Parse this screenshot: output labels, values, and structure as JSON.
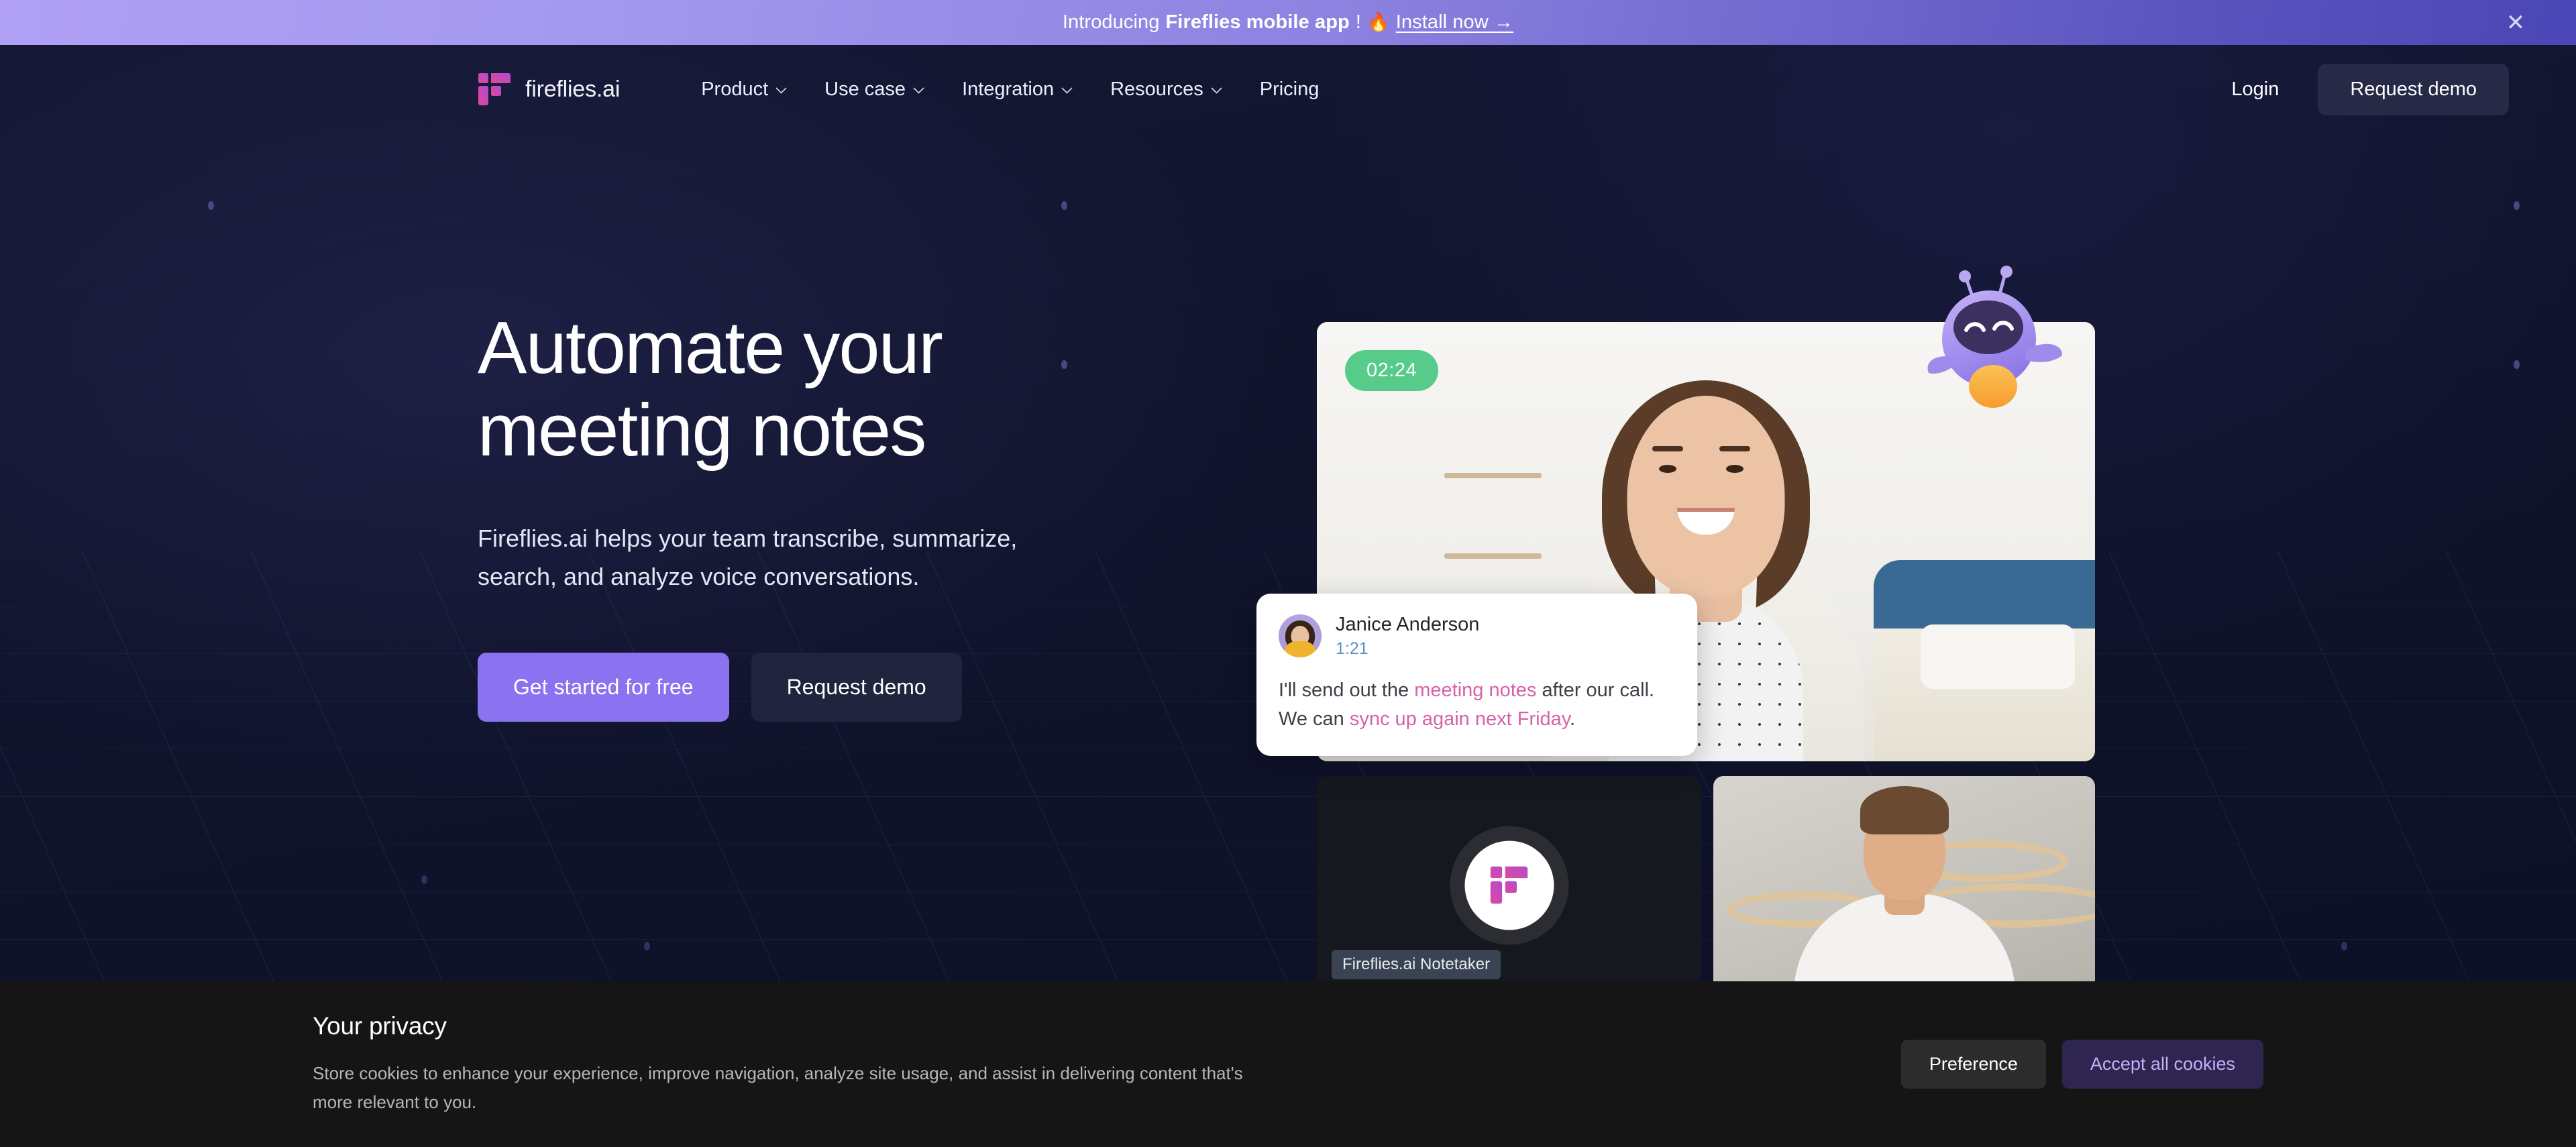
{
  "announcement": {
    "prefix": "Introducing",
    "strong": "Fireflies mobile app",
    "exclaim": "!",
    "emoji": "🔥",
    "link": "Install now →",
    "close_icon": "✕"
  },
  "nav": {
    "brand": "fireflies.ai",
    "logo_icon": "fireflies-logo-icon",
    "items": [
      {
        "label": "Product",
        "has_chevron": true
      },
      {
        "label": "Use case",
        "has_chevron": true
      },
      {
        "label": "Integration",
        "has_chevron": true
      },
      {
        "label": "Resources",
        "has_chevron": true
      },
      {
        "label": "Pricing",
        "has_chevron": false
      }
    ],
    "login_label": "Login",
    "demo_label": "Request demo"
  },
  "hero": {
    "title_line1": "Automate your",
    "title_line2": "meeting notes",
    "subtitle": "Fireflies.ai helps your team transcribe, summarize, search, and analyze voice conversations.",
    "cta_primary": "Get started for free",
    "cta_secondary": "Request demo",
    "accent_color": "#8b72f0"
  },
  "call": {
    "timer": "02:24",
    "timer_color": "#56cb8a",
    "mascot_icon": "fireflies-robot-mascot-icon",
    "transcript": {
      "speaker": "Janice Anderson",
      "timestamp": "1:21",
      "line1_a": "I'll send out the ",
      "line1_hl": "meeting notes",
      "line1_b": " after our call.",
      "line2_a": "We can ",
      "line2_hl": "sync up again next Friday",
      "line2_b": ".",
      "highlight_color": "#d761a8"
    },
    "notetaker_label": "Fireflies.ai Notetaker"
  },
  "cookies": {
    "title": "Your privacy",
    "body": "Store cookies to enhance your experience, improve navigation, analyze site usage, and assist in delivering content that's more relevant to you.",
    "preference_label": "Preference",
    "accept_label": "Accept all cookies",
    "accept_bg": "#2e2550",
    "accept_fg": "#bfb1f5"
  }
}
